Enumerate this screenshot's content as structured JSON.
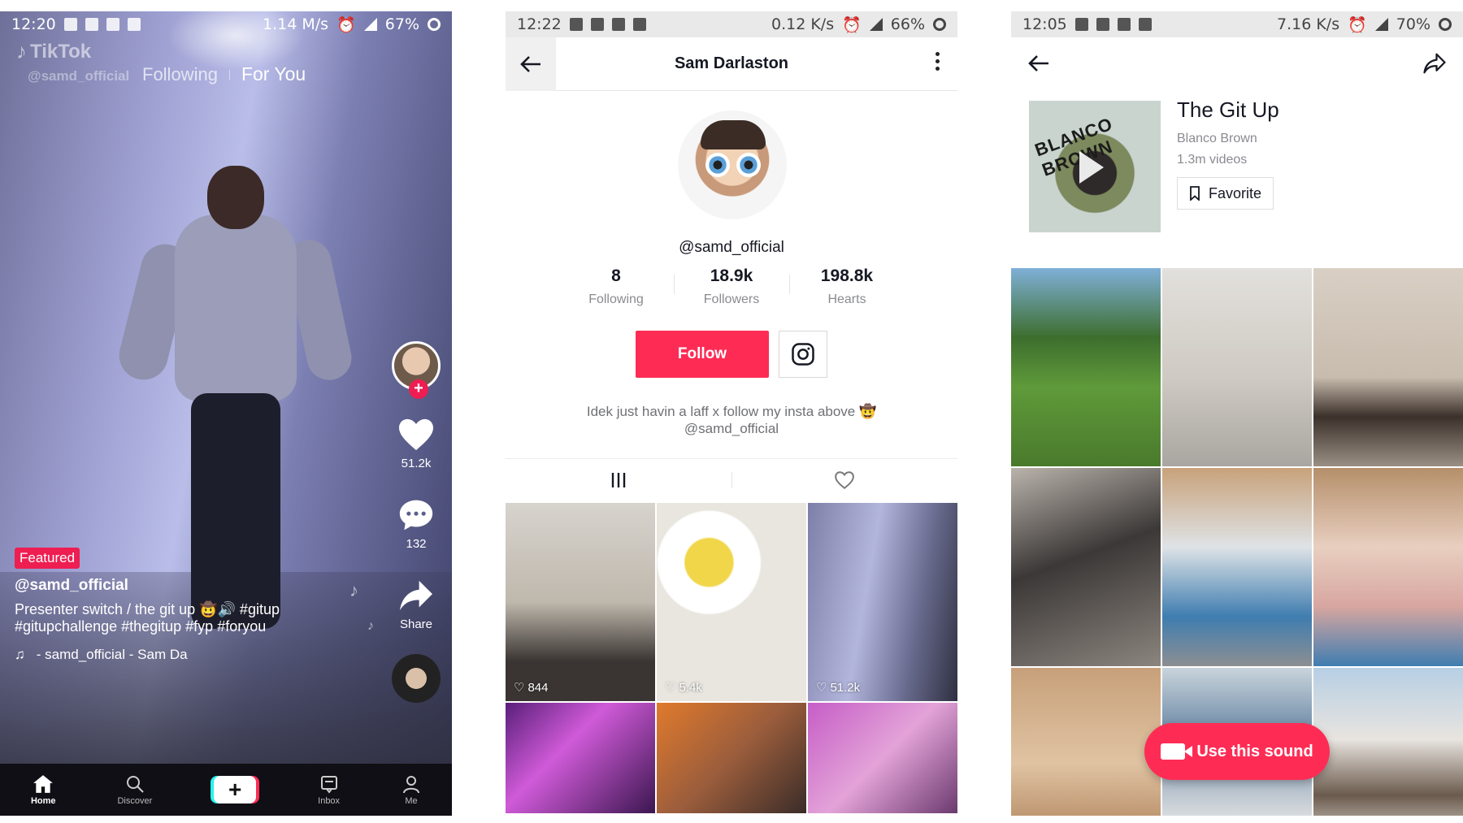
{
  "colors": {
    "brand_red": "#fe2c55",
    "text_dark": "#161823",
    "text_muted": "#8a8b91"
  },
  "feed": {
    "status": {
      "time": "12:20",
      "speed": "1.14 M/s",
      "battery": "67%"
    },
    "logo": "TikTok",
    "watermark_user": "@samd_official",
    "tabs": [
      {
        "label": "Following"
      },
      {
        "label": "For You"
      }
    ],
    "likes": "51.2k",
    "comments": "132",
    "share_label": "Share",
    "badge": "Featured",
    "username": "@samd_official",
    "caption": "Presenter switch / the git up 🤠🔊 #gitup #gitupchallenge #thegitup #fyp #foryou",
    "sound": "- samd_official - Sam Da",
    "nav": [
      {
        "label": "Home",
        "icon": "home-icon"
      },
      {
        "label": "Discover",
        "icon": "search-icon"
      },
      {
        "label": "",
        "icon": "plus-icon"
      },
      {
        "label": "Inbox",
        "icon": "inbox-icon"
      },
      {
        "label": "Me",
        "icon": "person-icon"
      }
    ]
  },
  "profile": {
    "status": {
      "time": "12:22",
      "speed": "0.12 K/s",
      "battery": "66%"
    },
    "title": "Sam Darlaston",
    "handle": "@samd_official",
    "stats": [
      {
        "value": "8",
        "label": "Following"
      },
      {
        "value": "18.9k",
        "label": "Followers"
      },
      {
        "value": "198.8k",
        "label": "Hearts"
      }
    ],
    "follow_label": "Follow",
    "bio": "Idek just havin a laff x follow my insta above 🤠 @samd_official",
    "videos": [
      {
        "likes": "844"
      },
      {
        "likes": "5.4k"
      },
      {
        "likes": "51.2k"
      },
      {
        "likes": ""
      },
      {
        "likes": ""
      },
      {
        "likes": ""
      }
    ]
  },
  "sound": {
    "status": {
      "time": "12:05",
      "speed": "7.16 K/s",
      "battery": "70%"
    },
    "album_text": "BLANCO BROWN",
    "title": "The Git Up",
    "artist": "Blanco Brown",
    "count": "1.3m videos",
    "favorite_label": "Favorite",
    "use_label": "Use this sound"
  }
}
